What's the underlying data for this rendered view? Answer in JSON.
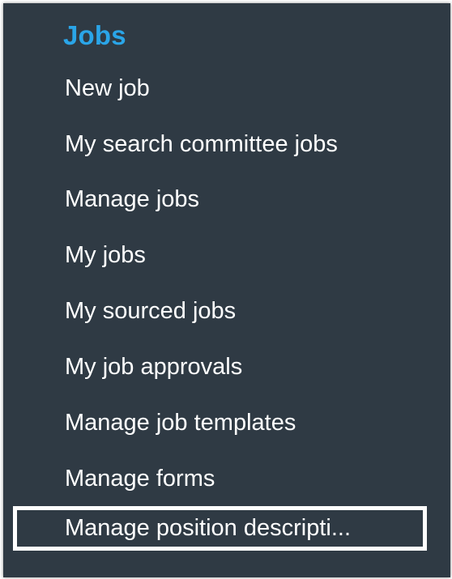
{
  "section": {
    "title": "Jobs"
  },
  "menu": {
    "items": [
      {
        "label": "New job"
      },
      {
        "label": "My search committee jobs"
      },
      {
        "label": "Manage jobs"
      },
      {
        "label": "My jobs"
      },
      {
        "label": "My sourced jobs"
      },
      {
        "label": "My job approvals"
      },
      {
        "label": "Manage job templates"
      },
      {
        "label": "Manage forms"
      },
      {
        "label": "Manage position descripti..."
      }
    ]
  },
  "colors": {
    "panel_background": "#2f3a44",
    "title_accent": "#2aa5e8",
    "text": "#ffffff",
    "highlight_border": "#ffffff"
  }
}
